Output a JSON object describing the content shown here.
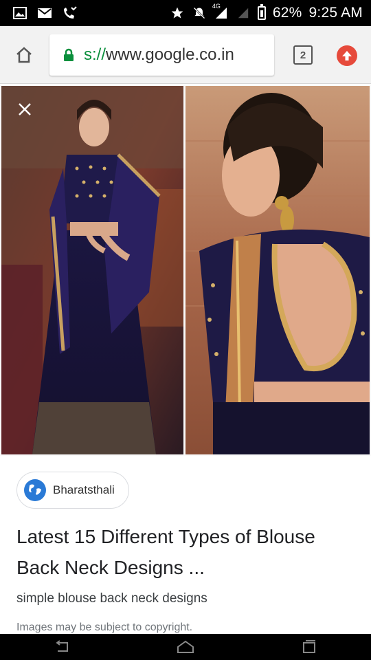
{
  "status_bar": {
    "network_label": "4G",
    "battery_percent": "62%",
    "time": "9:25 AM",
    "battery_level": 0.62
  },
  "browser": {
    "url_scheme": "s://",
    "url_host": "www.google.co.in",
    "tab_count": "2",
    "accent_color": "#e64a3b"
  },
  "result": {
    "source": "Bharatsthali",
    "title": "Latest 15 Different Types of Blouse Back Neck Designs ...",
    "snippet": "simple blouse back neck designs",
    "notice": "Images may be subject to copyright."
  }
}
